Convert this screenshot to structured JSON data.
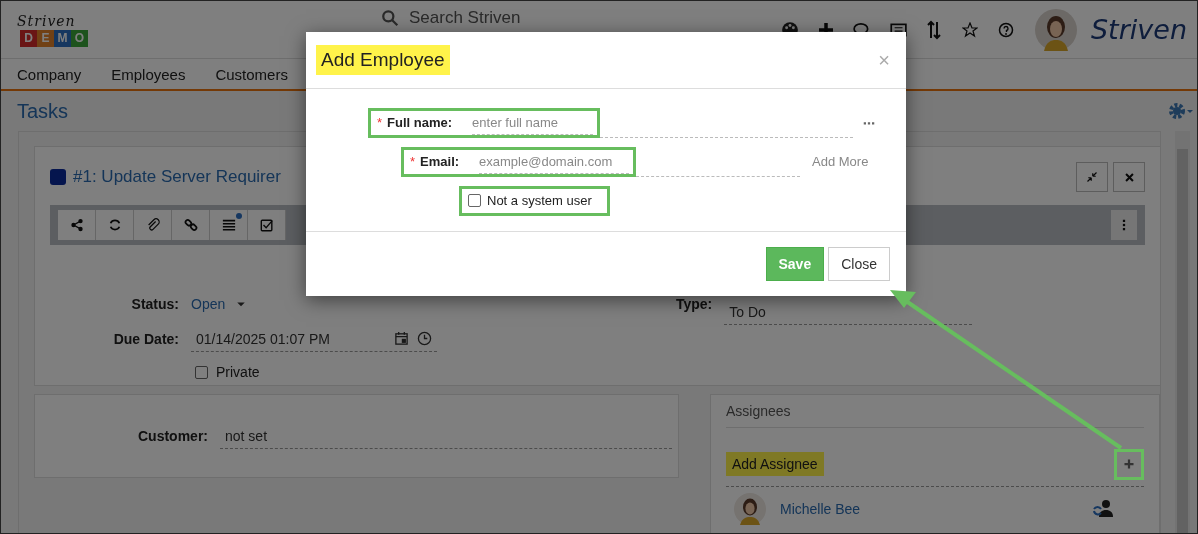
{
  "header": {
    "logo": {
      "script": "Striven",
      "letters": [
        "D",
        "E",
        "M",
        "O"
      ]
    },
    "search": {
      "placeholder": "Search Striven"
    },
    "brand": "Striven"
  },
  "nav": [
    "Company",
    "Employees",
    "Customers"
  ],
  "page": {
    "title": "Tasks"
  },
  "task": {
    "title": "#1: Update Server Requirer",
    "status": {
      "label": "Status:",
      "value": "Open"
    },
    "due": {
      "label": "Due Date:",
      "value": "01/14/2025 01:07 PM"
    },
    "type": {
      "label": "Type:",
      "value": "To Do"
    },
    "private": {
      "label": "Private",
      "checked": false
    }
  },
  "customer": {
    "label": "Customer:",
    "value": "not set"
  },
  "assignees": {
    "title": "Assignees",
    "add_label": "Add Assignee",
    "people": [
      {
        "name": "Michelle Bee"
      }
    ]
  },
  "dialog": {
    "title": "Add Employee",
    "close": "×",
    "fields": [
      {
        "label": "Full name:",
        "required_mark": "*",
        "placeholder": "enter full name"
      },
      {
        "label": "Email:",
        "required_mark": "*",
        "placeholder": "example@domain.com"
      }
    ],
    "add_more": "Add More",
    "system_user": {
      "label": "Not a system user",
      "checked": false
    },
    "buttons": [
      {
        "label": "Save",
        "kind": "primary"
      },
      {
        "label": "Close",
        "kind": "default"
      }
    ]
  }
}
